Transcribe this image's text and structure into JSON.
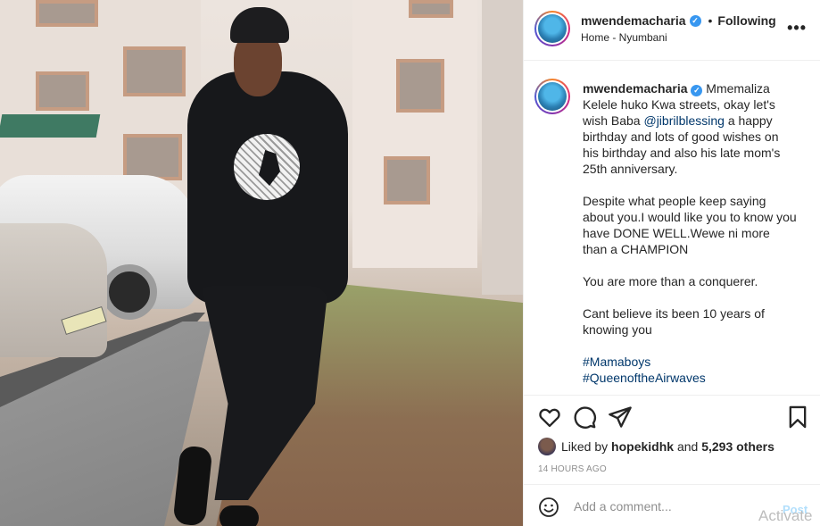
{
  "post": {
    "username": "mwendemacharia",
    "verified_mark": "✓",
    "separator": "•",
    "follow_status": "Following",
    "location": "Home - Nyumbani",
    "more_icon": "•••"
  },
  "caption": {
    "username": "mwendemacharia",
    "text_1": " Mmemaliza Kelele huko Kwa streets, okay let's wish Baba ",
    "mention": "@jibrilblessing",
    "text_2": " a happy birthday and lots of good wishes on his birthday and also his late mom's 25th anniversary.\n\nDespite what people keep saying about you.I would like you to know you have DONE WELL.Wewe ni more than a CHAMPION\n\nYou are more than a conquerer.\n\nCant believe its been 10 years of knowing you\n\n",
    "hashtags": [
      "#Mamaboys",
      "#QueenoftheAirwaves"
    ]
  },
  "actions": {
    "icons": [
      "heart-icon",
      "comment-icon",
      "share-icon",
      "bookmark-icon"
    ]
  },
  "likes": {
    "prefix": "Liked by ",
    "user": "hopekidhk",
    "middle": " and ",
    "count": "5,293 others"
  },
  "timestamp": "14 HOURS AGO",
  "comment": {
    "placeholder": "Add a comment...",
    "post_label": "Post",
    "emoji_icon": "smiley-icon"
  },
  "watermark": "Activate",
  "colors": {
    "link": "#00376b",
    "verified": "#3897f0",
    "post_disabled": "#b2dffc",
    "muted": "#8e8e8e"
  }
}
